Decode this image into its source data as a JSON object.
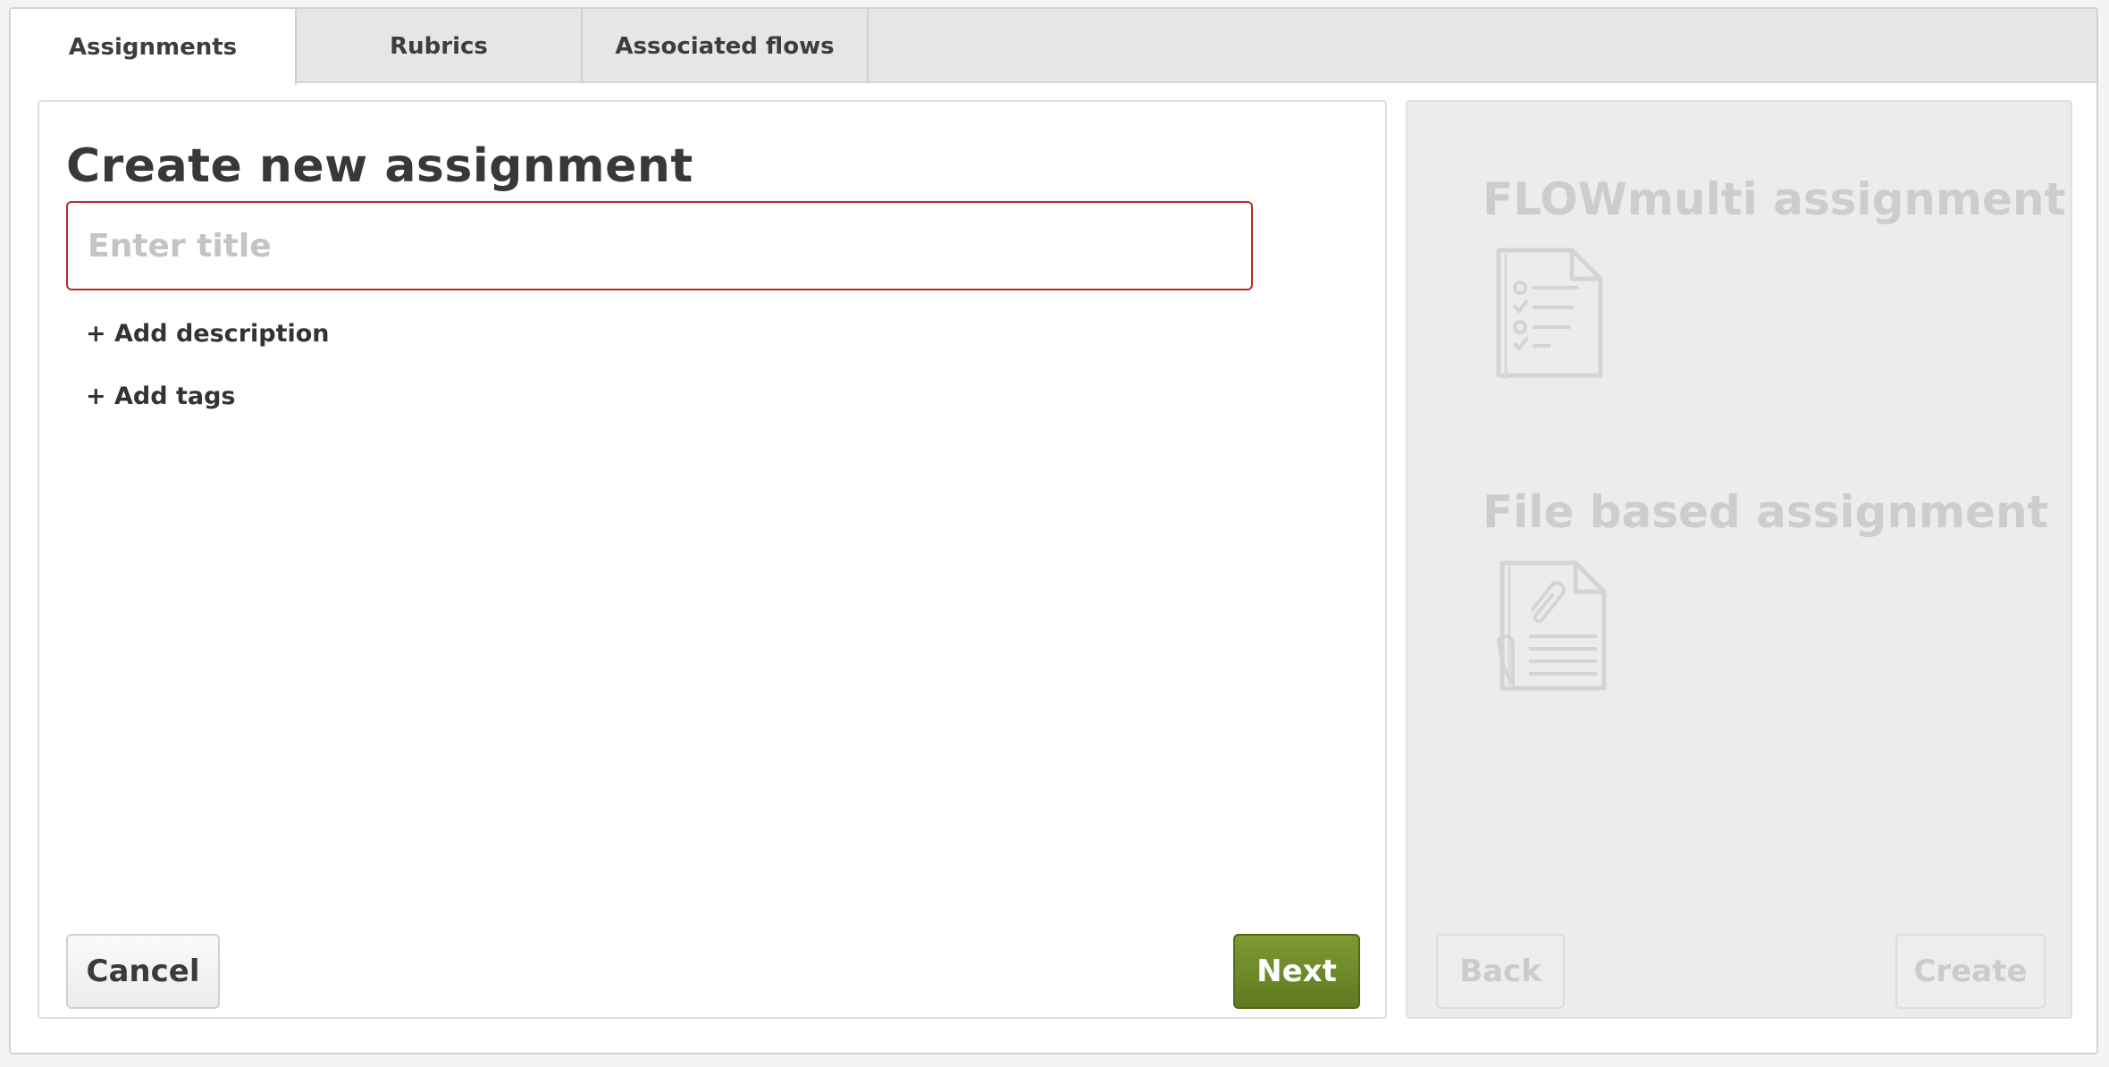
{
  "tabs": [
    {
      "label": "Assignments",
      "active": true
    },
    {
      "label": "Rubrics",
      "active": false
    },
    {
      "label": "Associated flows",
      "active": false
    }
  ],
  "editor": {
    "title": "Create new assignment",
    "title_input": {
      "value": "",
      "placeholder": "Enter title"
    },
    "add_description_label": "+ Add description",
    "add_tags_label": "+ Add tags",
    "cancel_label": "Cancel",
    "next_label": "Next"
  },
  "assignment_types": {
    "items": [
      {
        "title": "FLOWmulti assignment",
        "icon": "checklist-document-icon"
      },
      {
        "title": "File based assignment",
        "icon": "attachment-document-icon"
      }
    ],
    "back_label": "Back",
    "create_label": "Create"
  },
  "colors": {
    "accent_green": "#6b8a28",
    "input_error_border": "#b52b2b",
    "disabled_text": "#cbcbcb"
  }
}
